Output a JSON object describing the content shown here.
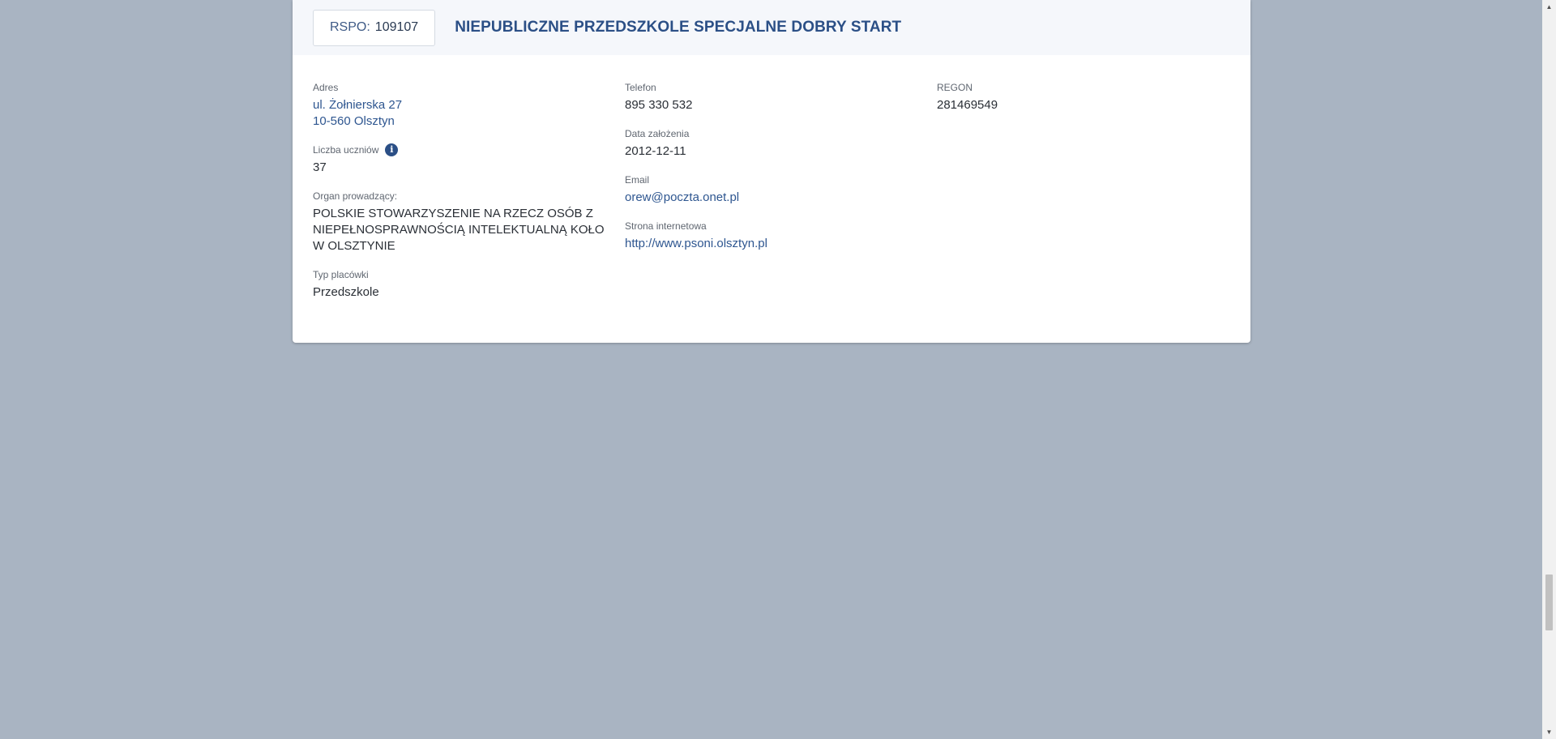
{
  "header": {
    "rspo_label": "RSPO:",
    "rspo_number": "109107",
    "school_name": "NIEPUBLICZNE PRZEDSZKOLE SPECJALNE DOBRY START"
  },
  "details": {
    "address_label": "Adres",
    "address_line1": "ul. Żołnierska 27",
    "address_line2": "10-560 Olsztyn",
    "students_label": "Liczba uczniów",
    "students_value": "37",
    "info_icon_glyph": "i",
    "authority_label": "Organ prowadzący:",
    "authority_value": "POLSKIE STOWARZYSZENIE NA RZECZ OSÓB Z NIEPEŁNOSPRAWNOŚCIĄ INTELEKTUALNĄ KOŁO W OLSZTYNIE",
    "type_label": "Typ placówki",
    "type_value": "Przedszkole",
    "phone_label": "Telefon",
    "phone_value": "895 330 532",
    "founded_label": "Data założenia",
    "founded_value": "2012-12-11",
    "email_label": "Email",
    "email_value": "orew@poczta.onet.pl",
    "website_label": "Strona internetowa",
    "website_value": "http://www.psoni.olsztyn.pl",
    "regon_label": "REGON",
    "regon_value": "281469549"
  },
  "colors": {
    "page_background": "#a9b4c2",
    "accent": "#2b4f86",
    "link": "#2e5690"
  },
  "icons": {
    "info": "info-icon",
    "scroll_up": "chevron-up-icon",
    "scroll_down": "chevron-down-icon"
  }
}
